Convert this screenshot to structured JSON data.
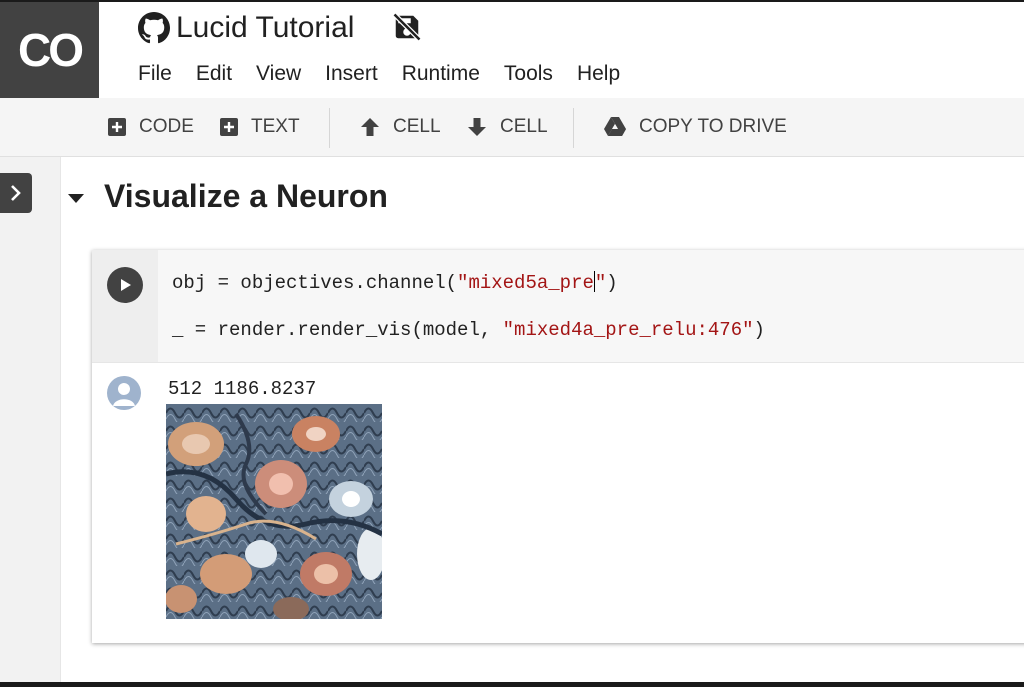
{
  "app": {
    "logo_text": "CO",
    "title": "Lucid Tutorial"
  },
  "menu": [
    "File",
    "Edit",
    "View",
    "Insert",
    "Runtime",
    "Tools",
    "Help"
  ],
  "toolbar": {
    "code_label": "CODE",
    "text_label": "TEXT",
    "cell_up_label": "CELL",
    "cell_down_label": "CELL",
    "copy_label": "COPY TO DRIVE"
  },
  "section": {
    "title": "Visualize a Neuron"
  },
  "cell": {
    "line1_pre": "obj = objectives.channel(",
    "line1_str_a": "\"mixed5a_pre",
    "line1_str_b": "\"",
    "line1_post": ")",
    "line2_pre": "_ = render.render_vis(model, ",
    "line2_str": "\"mixed4a_pre_relu:476\"",
    "line2_post": ")"
  },
  "output": {
    "text": "512 1186.8237"
  },
  "colors": {
    "logo_bg": "#424242",
    "toolbar_bg": "#f5f5f5",
    "string": "#a31515",
    "code_bg": "#f7f7f7"
  },
  "icons": {
    "github": "github-icon",
    "nosave": "crossed-out-disk-icon",
    "run": "play-icon",
    "drive": "drive-icon"
  }
}
